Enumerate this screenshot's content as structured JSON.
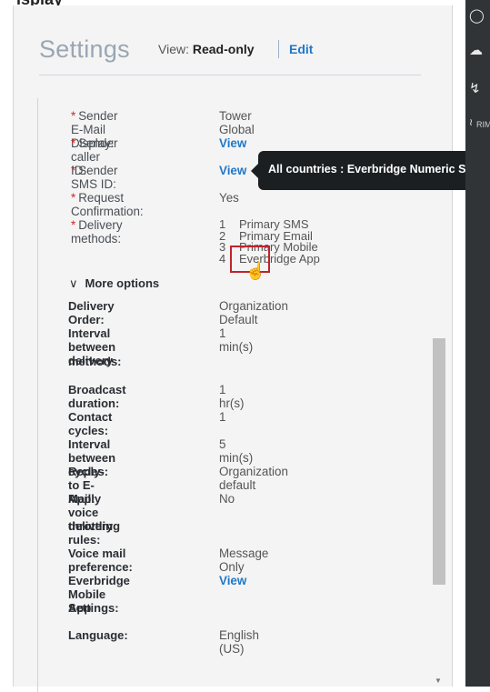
{
  "page_top_cut": "isplay",
  "header": {
    "title": "Settings",
    "view_prefix": "View:",
    "view_mode": "Read-only",
    "edit_label": "Edit"
  },
  "required_fields": [
    {
      "label": "Sender E-Mail Display:",
      "value": "Tower Global"
    },
    {
      "label": "Sender caller ID:",
      "value": "View"
    },
    {
      "label": "Sender SMS ID:",
      "value": "View"
    },
    {
      "label": "Request Confirmation:",
      "value": "Yes"
    },
    {
      "label": "Delivery methods:",
      "value": ""
    }
  ],
  "delivery_methods": [
    {
      "n": "1",
      "name": "Primary SMS"
    },
    {
      "n": "2",
      "name": "Primary Email"
    },
    {
      "n": "3",
      "name": "Primary Mobile"
    },
    {
      "n": "4",
      "name": "Everbridge App"
    }
  ],
  "more_options_label": "More options",
  "options": [
    {
      "label": "Delivery Order:",
      "value": "Organization Default"
    },
    {
      "label": "Interval between delivery",
      "value": "1 min(s)"
    },
    {
      "label": "methods:",
      "value": ""
    },
    {
      "label": "Broadcast duration:",
      "value": "1 hr(s)"
    },
    {
      "label": "Contact cycles:",
      "value": "1"
    },
    {
      "label": "Interval between cycles:",
      "value": "5 min(s)"
    },
    {
      "label": "Reply-to E-Mail:",
      "value": "Organization default"
    },
    {
      "label": "Apply voice delivery",
      "value": "No"
    },
    {
      "label": "throttling rules:",
      "value": ""
    },
    {
      "label": "Voice mail preference:",
      "value": "Message Only"
    },
    {
      "label": "Everbridge Mobile App",
      "value": "View"
    },
    {
      "label": "Settings:",
      "value": ""
    },
    {
      "label": "Language:",
      "value": "English (US)"
    }
  ],
  "tooltip": "All countries : Everbridge Numeric SMS ID",
  "rightbar": {
    "icons": [
      "shield-icon",
      "cloud-rain-icon",
      "usb-icon",
      "rim-icon"
    ],
    "rim_text": "RIMO"
  },
  "colors": {
    "link": "#1f78c8",
    "required_star": "#cc2a2a",
    "highlight_box": "#c0232b",
    "tooltip_bg": "#1c1f22",
    "rightbar_bg": "#303437"
  }
}
